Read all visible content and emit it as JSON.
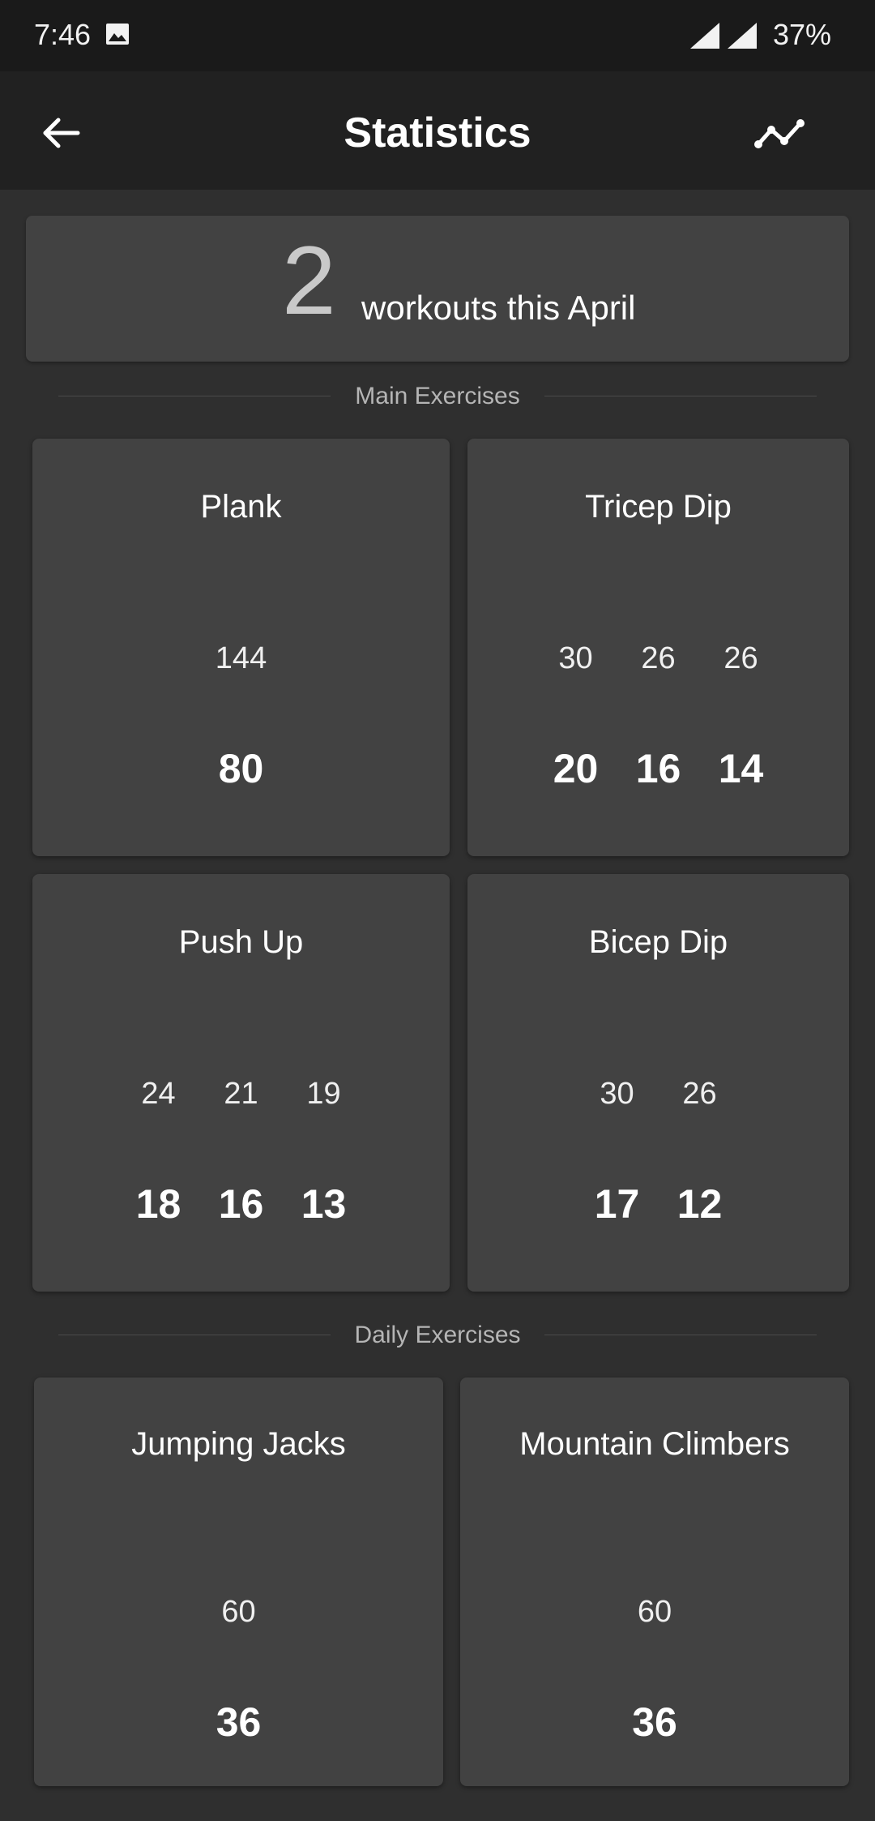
{
  "status_bar": {
    "time": "7:46",
    "battery": "37%",
    "icons": [
      "image-icon",
      "signal-icon",
      "signal-icon"
    ]
  },
  "app_bar": {
    "title": "Statistics",
    "back_icon": "arrow-left-icon",
    "trend_icon": "trend-line-icon"
  },
  "summary": {
    "count": "2",
    "text": "workouts this April"
  },
  "sections": {
    "main": "Main Exercises",
    "daily": "Daily Exercises"
  },
  "main_exercises": [
    {
      "name": "Plank",
      "top": [
        "144"
      ],
      "bottom": [
        "80"
      ]
    },
    {
      "name": "Tricep Dip",
      "top": [
        "30",
        "26",
        "26"
      ],
      "bottom": [
        "20",
        "16",
        "14"
      ]
    },
    {
      "name": "Push Up",
      "top": [
        "24",
        "21",
        "19"
      ],
      "bottom": [
        "18",
        "16",
        "13"
      ]
    },
    {
      "name": "Bicep Dip",
      "top": [
        "30",
        "26"
      ],
      "bottom": [
        "17",
        "12"
      ]
    }
  ],
  "daily_exercises": [
    {
      "name": "Jumping Jacks",
      "top": [
        "60"
      ],
      "bottom": [
        "36"
      ]
    },
    {
      "name": "Mountain Climbers",
      "top": [
        "60"
      ],
      "bottom": [
        "36"
      ]
    }
  ],
  "colors": {
    "background": "#2f2f2f",
    "app_bar": "#212121",
    "status_bar": "#1a1a1a",
    "card": "#424242",
    "summary_count": "#c9c9c9"
  }
}
